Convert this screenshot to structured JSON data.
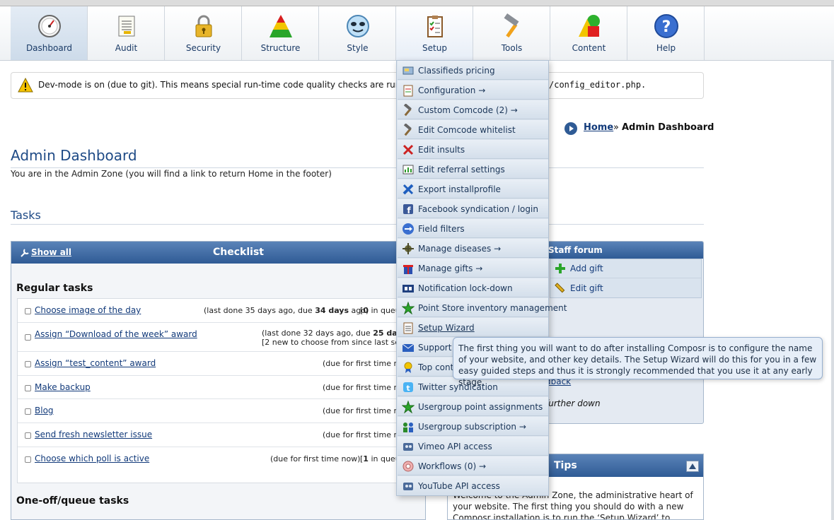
{
  "nav": {
    "items": [
      {
        "label": "Dashboard",
        "icon": "dashboard-gauge-icon"
      },
      {
        "label": "Audit",
        "icon": "audit-document-icon"
      },
      {
        "label": "Security",
        "icon": "padlock-icon"
      },
      {
        "label": "Structure",
        "icon": "triangle-structure-icon"
      },
      {
        "label": "Style",
        "icon": "style-face-icon"
      },
      {
        "label": "Setup",
        "icon": "clipboard-checklist-icon"
      },
      {
        "label": "Tools",
        "icon": "hammer-icon"
      },
      {
        "label": "Content",
        "icon": "shapes-icon"
      },
      {
        "label": "Help",
        "icon": "question-mark-icon"
      }
    ]
  },
  "notice": {
    "text": "Dev-mode is on (due to git). This means special run-time code quality checks are runnin",
    "code": "/config_editor.php."
  },
  "breadcrumb": {
    "home": "Home",
    "separator": "»",
    "current": "Admin Dashboard"
  },
  "page": {
    "title": "Admin Dashboard",
    "intro": "You are in the Admin Zone (you will find a link to return Home in the footer)",
    "tasks_heading": "Tasks"
  },
  "checklist": {
    "show_all": "Show all",
    "title": "Checklist",
    "regular_heading": "Regular tasks",
    "oneoff_heading": "One-off/queue tasks",
    "tasks": [
      {
        "label": "Choose image of the day",
        "meta_pre": "(last done 35 days ago, due ",
        "meta_bold": "34 days",
        "meta_post": " ago)",
        "queue_pre": "[",
        "queue_bold": "0",
        "queue_post": " in queue"
      },
      {
        "label": "Assign “Download of the week” award",
        "meta_pre": "(last done 32 days ago, due ",
        "meta_bold": "25 days",
        "meta_post": " a",
        "line2": "[2 new to choose from since last settin"
      },
      {
        "label": "Assign “test_content” award",
        "meta_pre": "(due for first time now"
      },
      {
        "label": "Make backup",
        "meta_pre": "(due for first time now"
      },
      {
        "label": "Blog",
        "meta_pre": "(due for first time now"
      },
      {
        "label": "Send fresh newsletter issue",
        "meta_pre": "(due for first time now"
      },
      {
        "label": "Choose which poll is active",
        "meta_pre": "(due for first time now)",
        "queue_pre": "[",
        "queue_bold": "1",
        "queue_post": " in queue"
      }
    ]
  },
  "staff_forum": {
    "title": "Staff forum",
    "items": [
      {
        "label": "Add gift",
        "icon": "green-plus-icon"
      },
      {
        "label": "Edit gift",
        "icon": "pencil-icon"
      }
    ],
    "link_fragment": "dback",
    "italic_fragment": "further down"
  },
  "tips": {
    "title": "Tips",
    "body_line1": "Welcome to the Admin Zone, the administrative heart of",
    "body_line2": "your website. The first thing you should do with a new",
    "body_line3": "Composr installation is to run the ‘Setup Wizard’ to perform"
  },
  "setup_menu": {
    "items": [
      {
        "label": "Classifieds pricing",
        "icon": "classifieds-icon"
      },
      {
        "label": "Configuration →",
        "icon": "configuration-icon"
      },
      {
        "label": "Custom Comcode (2) →",
        "icon": "custom-comcode-icon"
      },
      {
        "label": "Edit Comcode whitelist",
        "icon": "comcode-whitelist-icon"
      },
      {
        "label": "Edit insults",
        "icon": "insults-icon"
      },
      {
        "label": "Edit referral settings",
        "icon": "referral-icon"
      },
      {
        "label": "Export installprofile",
        "icon": "export-wrench-icon"
      },
      {
        "label": "Facebook syndication / login",
        "icon": "facebook-icon"
      },
      {
        "label": "Field filters",
        "icon": "field-filters-icon"
      },
      {
        "label": "Manage diseases →",
        "icon": "disease-icon"
      },
      {
        "label": "Manage gifts →",
        "icon": "gift-icon"
      },
      {
        "label": "Notification lock-down",
        "icon": "notification-lockdown-icon"
      },
      {
        "label": "Point Store inventory management",
        "icon": "green-star-icon"
      },
      {
        "label": "Setup Wizard",
        "icon": "setup-wizard-icon"
      },
      {
        "label": "Support ti",
        "icon": "support-tickets-icon"
      },
      {
        "label": "Top conte",
        "icon": "award-ribbon-icon"
      },
      {
        "label": "Twitter syndication",
        "icon": "twitter-icon"
      },
      {
        "label": "Usergroup point assignments",
        "icon": "green-star-icon"
      },
      {
        "label": "Usergroup subscription →",
        "icon": "usergroup-icon"
      },
      {
        "label": "Vimeo API access",
        "icon": "vimeo-icon"
      },
      {
        "label": "Workflows (0) →",
        "icon": "workflows-icon"
      },
      {
        "label": "YouTube API access",
        "icon": "youtube-icon"
      }
    ]
  },
  "tooltip": {
    "text": "The first thing you will want to do after installing Composr is to configure the name of your website, and other key details. The Setup Wizard will do this for you in a few easy guided steps and thus it is strongly recommended that you use it at any early stage."
  },
  "colors": {
    "accent": "#2f5b95",
    "link": "#123a7a",
    "menu_bg": "#dbe4ee"
  }
}
